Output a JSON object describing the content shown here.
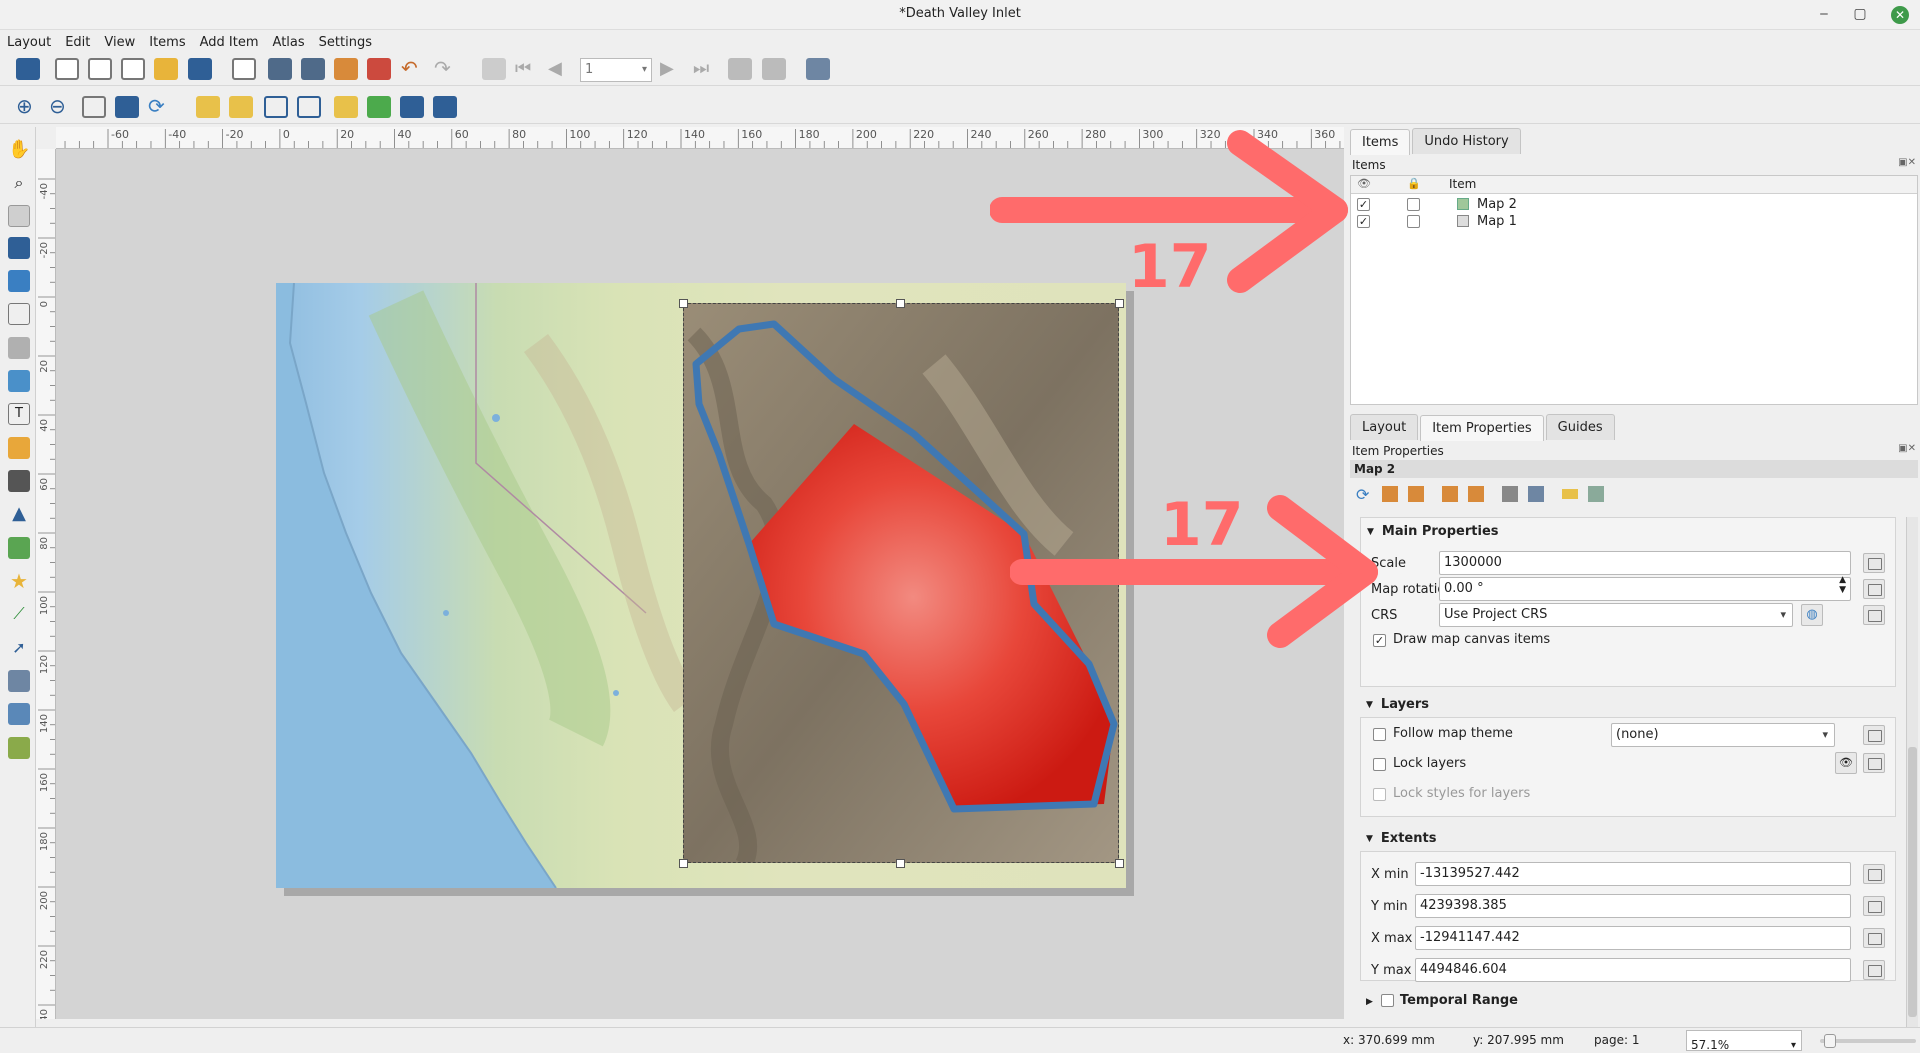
{
  "window": {
    "title": "*Death Valley Inlet",
    "minimize": "‒",
    "maximize": "▢",
    "close": "✕"
  },
  "menu": [
    "Layout",
    "Edit",
    "View",
    "Items",
    "Add Item",
    "Atlas",
    "Settings"
  ],
  "toolbar": {
    "page_number": "1"
  },
  "ruler_top_ticks": [
    "-60",
    "-40",
    "-20",
    "0",
    "20",
    "40",
    "60",
    "80",
    "100",
    "120",
    "140",
    "160",
    "180",
    "200",
    "220",
    "240",
    "260",
    "280",
    "300",
    "320",
    "340",
    "360"
  ],
  "ruler_left_ticks": [
    "-40",
    "-20",
    "0",
    "20",
    "40",
    "60",
    "80",
    "100",
    "120",
    "140",
    "160",
    "180",
    "200",
    "220",
    "240"
  ],
  "items_panel": {
    "tabs": [
      "Items",
      "Undo History"
    ],
    "active_tab": "Items",
    "title": "Items",
    "column_item": "Item",
    "rows": [
      {
        "label": "Map 2",
        "visible": true,
        "locked": false
      },
      {
        "label": "Map 1",
        "visible": true,
        "locked": false
      }
    ]
  },
  "props_panel": {
    "tabs": [
      "Layout",
      "Item Properties",
      "Guides"
    ],
    "active_tab": "Item Properties",
    "title": "Item Properties",
    "item_name": "Map 2",
    "main_properties": "Main Properties",
    "scale_label": "Scale",
    "scale_value": "1300000",
    "rotation_label": "Map rotation",
    "rotation_value": "0.00 °",
    "crs_label": "CRS",
    "crs_value": "Use Project CRS",
    "draw_canvas_items": "Draw map canvas items",
    "layers_section": "Layers",
    "follow_theme": "Follow map theme",
    "theme_value": "(none)",
    "lock_layers": "Lock layers",
    "lock_styles": "Lock styles for layers",
    "extents_section": "Extents",
    "xmin_label": "X min",
    "xmin_value": "-13139527.442",
    "ymin_label": "Y min",
    "ymin_value": "4239398.385",
    "xmax_label": "X max",
    "xmax_value": "-12941147.442",
    "ymax_label": "Y max",
    "ymax_value": "4494846.604",
    "temporal_section": "Temporal Range"
  },
  "annotations": {
    "label_top": "17",
    "label_mid": "17",
    "color": "#ff6b6b"
  },
  "status": {
    "x": "x: 370.699 mm",
    "y": "y: 207.995 mm",
    "page": "page: 1",
    "zoom": "57.1%"
  }
}
